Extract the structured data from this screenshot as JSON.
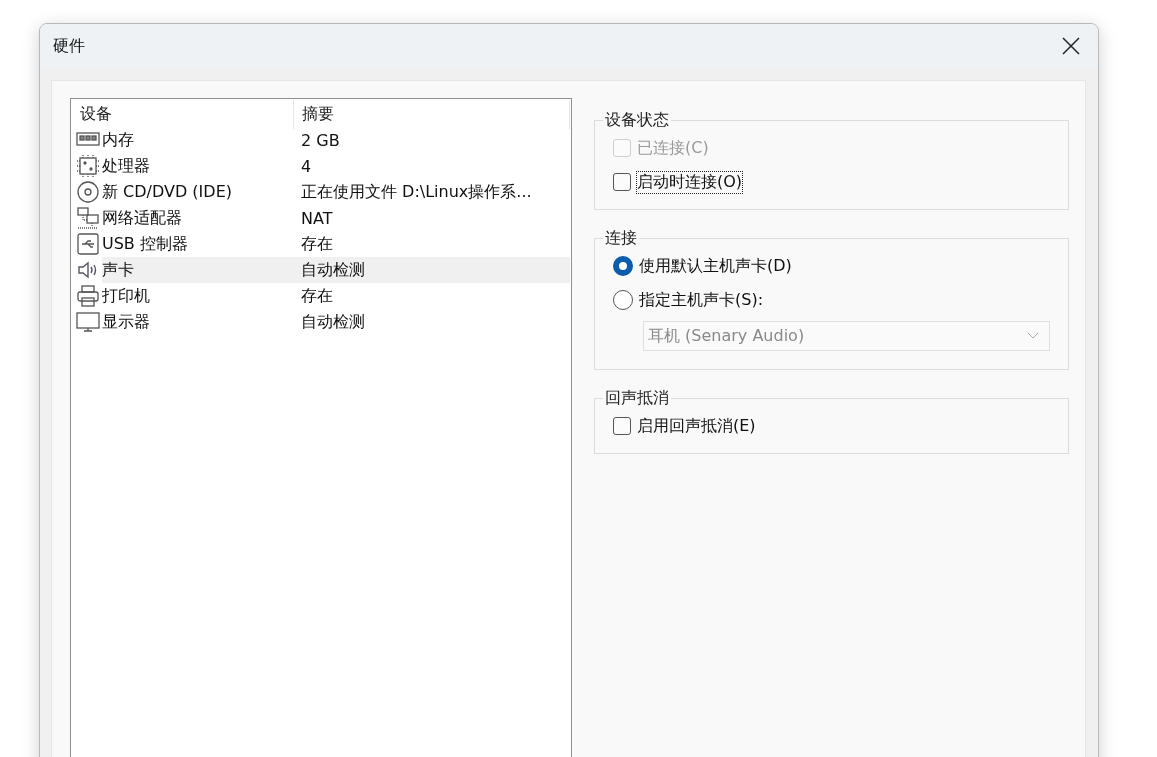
{
  "window": {
    "title": "硬件"
  },
  "device_table": {
    "columns": [
      "设备",
      "摘要"
    ],
    "rows": [
      {
        "kind": "memory",
        "device": "内存",
        "summary": "2 GB",
        "selected": false
      },
      {
        "kind": "cpu",
        "device": "处理器",
        "summary": "4",
        "selected": false
      },
      {
        "kind": "disc",
        "device": "新 CD/DVD (IDE)",
        "summary": "正在使用文件 D:\\Linux操作系...",
        "selected": false
      },
      {
        "kind": "network",
        "device": "网络适配器",
        "summary": "NAT",
        "selected": false
      },
      {
        "kind": "usb",
        "device": "USB 控制器",
        "summary": "存在",
        "selected": false
      },
      {
        "kind": "sound",
        "device": "声卡",
        "summary": "自动检测",
        "selected": true
      },
      {
        "kind": "printer",
        "device": "打印机",
        "summary": "存在",
        "selected": false
      },
      {
        "kind": "display",
        "device": "显示器",
        "summary": "自动检测",
        "selected": false
      }
    ]
  },
  "device_status": {
    "title": "设备状态",
    "options": [
      {
        "label": "已连接(C)",
        "checked": false,
        "disabled": true,
        "focused": false
      },
      {
        "label": "启动时连接(O)",
        "checked": false,
        "disabled": false,
        "focused": true
      }
    ]
  },
  "connection": {
    "title": "连接",
    "options": [
      {
        "label": "使用默认主机声卡(D)",
        "selected": true
      },
      {
        "label": "指定主机声卡(S):",
        "selected": false
      }
    ],
    "host_card": {
      "value": "耳机 (Senary Audio)",
      "disabled": true
    }
  },
  "echo_cancel": {
    "title": "回声抵消",
    "options": [
      {
        "label": "启用回声抵消(E)",
        "checked": false,
        "disabled": false,
        "focused": false
      }
    ]
  }
}
